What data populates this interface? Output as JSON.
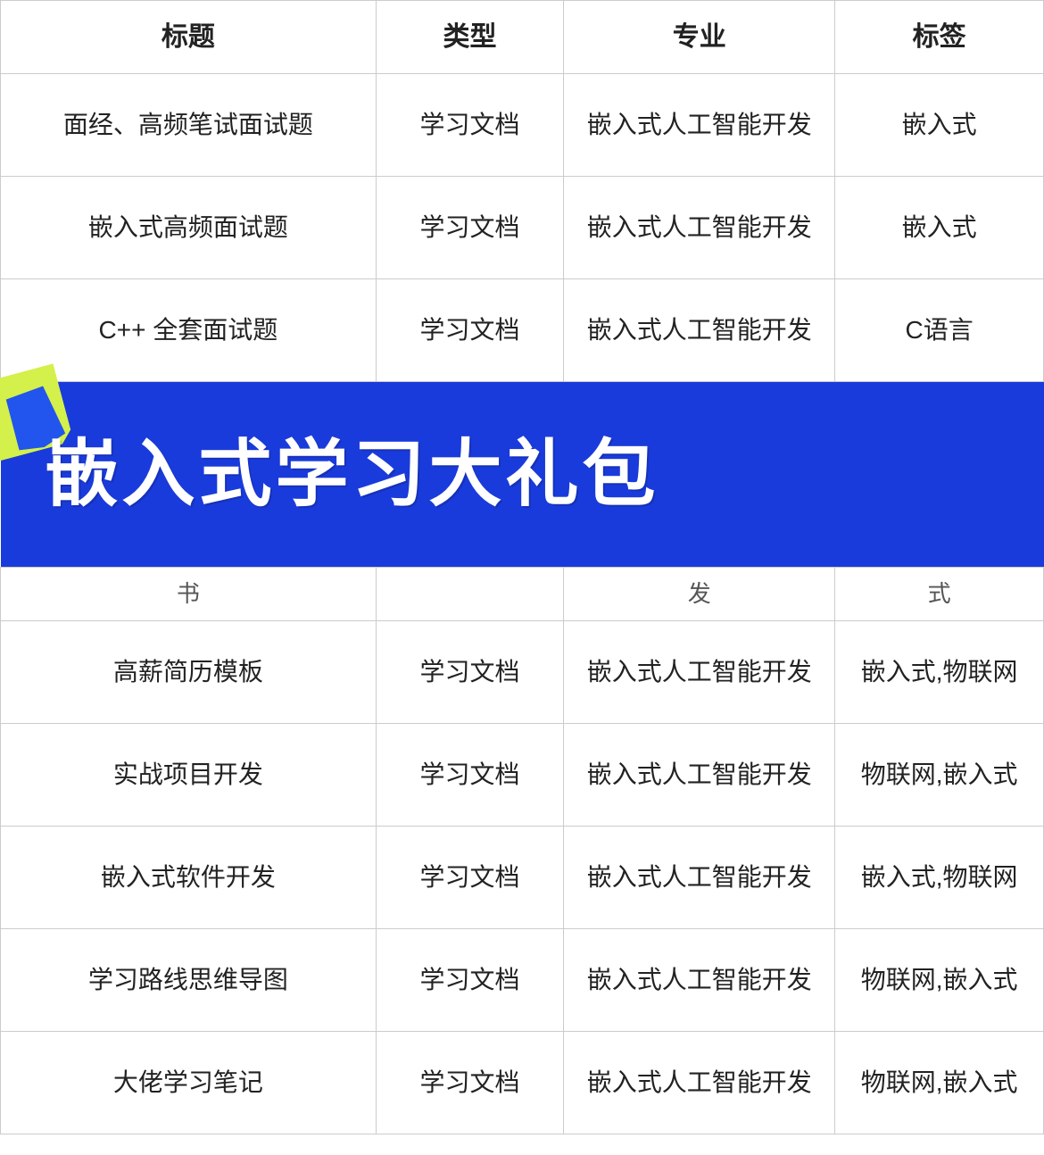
{
  "headers": {
    "col1": "标题",
    "col2": "类型",
    "col3": "专业",
    "col4": "标签"
  },
  "rows": [
    {
      "title": "面经、高频笔试面试题",
      "type": "学习文档",
      "major": "嵌入式人工智能开发",
      "tag": "嵌入式"
    },
    {
      "title": "嵌入式高频面试题",
      "type": "学习文档",
      "major": "嵌入式人工智能开发",
      "tag": "嵌入式"
    },
    {
      "title": "C++ 全套面试题",
      "type": "学习文档",
      "major": "嵌入式人工智能开发",
      "tag": "C语言"
    }
  ],
  "banner": {
    "text": "嵌入式学习大礼包"
  },
  "partial_row": {
    "col1": "书",
    "col2": "",
    "col3": "发",
    "col4": "式"
  },
  "bottom_rows": [
    {
      "title": "高薪简历模板",
      "type": "学习文档",
      "major": "嵌入式人工智能开发",
      "tag": "嵌入式,物联网"
    },
    {
      "title": "实战项目开发",
      "type": "学习文档",
      "major": "嵌入式人工智能开发",
      "tag": "物联网,嵌入式"
    },
    {
      "title": "嵌入式软件开发",
      "type": "学习文档",
      "major": "嵌入式人工智能开发",
      "tag": "嵌入式,物联网"
    },
    {
      "title": "学习路线思维导图",
      "type": "学习文档",
      "major": "嵌入式人工智能开发",
      "tag": "物联网,嵌入式"
    },
    {
      "title": "大佬学习笔记",
      "type": "学习文档",
      "major": "嵌入式人工智能开发",
      "tag": "物联网,嵌入式"
    }
  ]
}
